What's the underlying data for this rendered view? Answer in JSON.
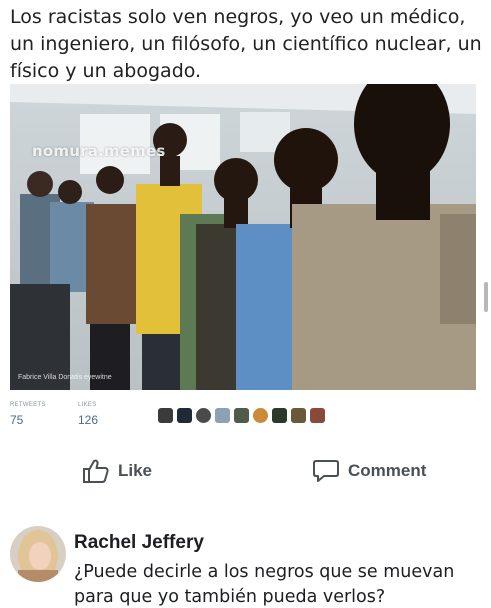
{
  "post": {
    "caption": "Los racistas solo ven negros, yo veo un médico, un ingeniero, un filósofo, un científico nuclear, un físico y un abogado.",
    "image": {
      "watermark": "nomura.memes",
      "credit": "Fabrice Villa Donatis eyewitne"
    }
  },
  "stats": {
    "left_label": "RETWEETS",
    "left_value": "75",
    "right_label": "LIKES",
    "right_value": "126"
  },
  "reaction_icons": [
    "avatar-icon",
    "avatar-icon",
    "avatar-icon",
    "avatar-icon",
    "avatar-icon",
    "avatar-icon",
    "avatar-icon",
    "avatar-icon"
  ],
  "actions": {
    "like_label": "Like",
    "comment_label": "Comment",
    "icon_color": "#4b4f56"
  },
  "comment": {
    "author": "Rachel Jeffery",
    "text": "¿Puede decirle a los negros que se muevan para que yo también pueda verlos?"
  }
}
